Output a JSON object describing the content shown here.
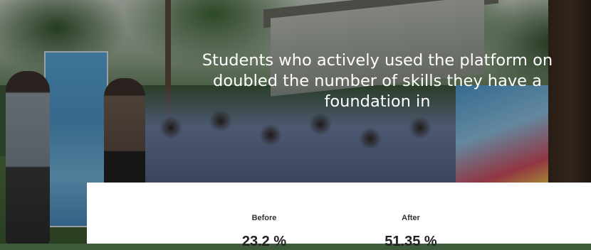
{
  "hero": {
    "headline_lines": [
      "Students who actively used the platform on",
      "doubled the number of skills they have a",
      "foundation in"
    ]
  },
  "stats": {
    "before": {
      "label": "Before",
      "value": "23.2 %"
    },
    "after": {
      "label": "After",
      "value": "51.35 %"
    }
  },
  "colors": {
    "headline_text": "#ffffff",
    "card_background": "#ffffff",
    "stat_text": "#222222"
  }
}
